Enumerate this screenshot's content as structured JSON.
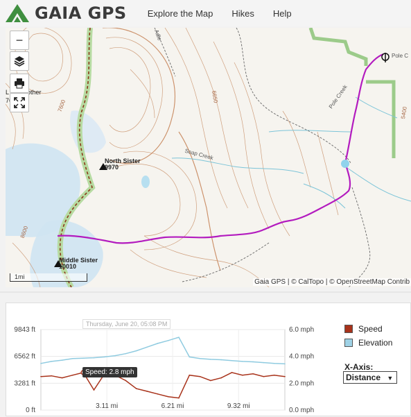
{
  "header": {
    "brand": "GAIA GPS",
    "nav": [
      "Explore the Map",
      "Hikes",
      "Help"
    ]
  },
  "map": {
    "peaks": [
      {
        "name": "North Sister",
        "elevation": "9970"
      },
      {
        "name": "Middle Sister",
        "elevation": "10010"
      }
    ],
    "labels": {
      "pole_creek": "Pole Creek",
      "pole_cr": "Pole C",
      "soap_creek": "Soap Creek",
      "brother": "Brother",
      "brother_elev": "76",
      "contour_7600": "7600",
      "contour_6650": "6650",
      "contour_5400": "5400",
      "contour_8600": "8600",
      "edge_l": "L",
      "edge_a": "Adle"
    },
    "scale_label": "1mi",
    "attribution": "Gaia GPS | © CalTopo | © OpenStreetMap Contrib",
    "controls": {
      "zoom_out": "−"
    }
  },
  "chart_data": {
    "type": "line",
    "title": "",
    "x": [
      0,
      0.5,
      1,
      1.5,
      2,
      2.5,
      3,
      3.5,
      4,
      4.5,
      5,
      5.5,
      6,
      6.5,
      7,
      7.5,
      8,
      8.5,
      9,
      9.5,
      10,
      10.5,
      11,
      11.5
    ],
    "x_ticks": [
      "3.11 mi",
      "6.21 mi",
      "9.32 mi"
    ],
    "y_left_ticks": [
      "9843 ft",
      "6562 ft",
      "3281 ft",
      "0 ft"
    ],
    "y_right_ticks": [
      "6.0 mph",
      "4.0 mph",
      "2.0 mph",
      "0.0 mph"
    ],
    "series": [
      {
        "name": "Speed",
        "color": "#a8321a",
        "axis": "right",
        "values": [
          2.5,
          2.55,
          2.4,
          2.6,
          2.8,
          1.5,
          2.7,
          2.6,
          2.2,
          1.6,
          1.4,
          1.2,
          1.0,
          0.9,
          2.6,
          2.5,
          2.2,
          2.4,
          2.8,
          2.6,
          2.7,
          2.5,
          2.6,
          2.5
        ]
      },
      {
        "name": "Elevation",
        "color": "#8fcbe0",
        "axis": "left",
        "values": [
          5700,
          5950,
          6100,
          6300,
          6350,
          6400,
          6500,
          6650,
          6900,
          7250,
          7700,
          8150,
          8500,
          8900,
          6500,
          6300,
          6200,
          6150,
          6050,
          5950,
          5900,
          5800,
          5700,
          5650
        ]
      }
    ],
    "ylim_left": [
      0,
      9843
    ],
    "ylim_right": [
      0,
      6.0
    ],
    "xlim": [
      0,
      11.5
    ],
    "grid": true,
    "legend": "right",
    "tooltip_date": "Thursday, June 20, 05:08 PM",
    "cursor_label": "Speed: 2.8 mph",
    "x_axis_title": "X-Axis:",
    "x_axis_value": "Distance",
    "x_axis_caret": "▼"
  },
  "colors": {
    "brand_green": "#3f8f3f",
    "track": "#b31bbf",
    "trail": "#8b3a1a",
    "wilderness": "#9ccb8a"
  }
}
